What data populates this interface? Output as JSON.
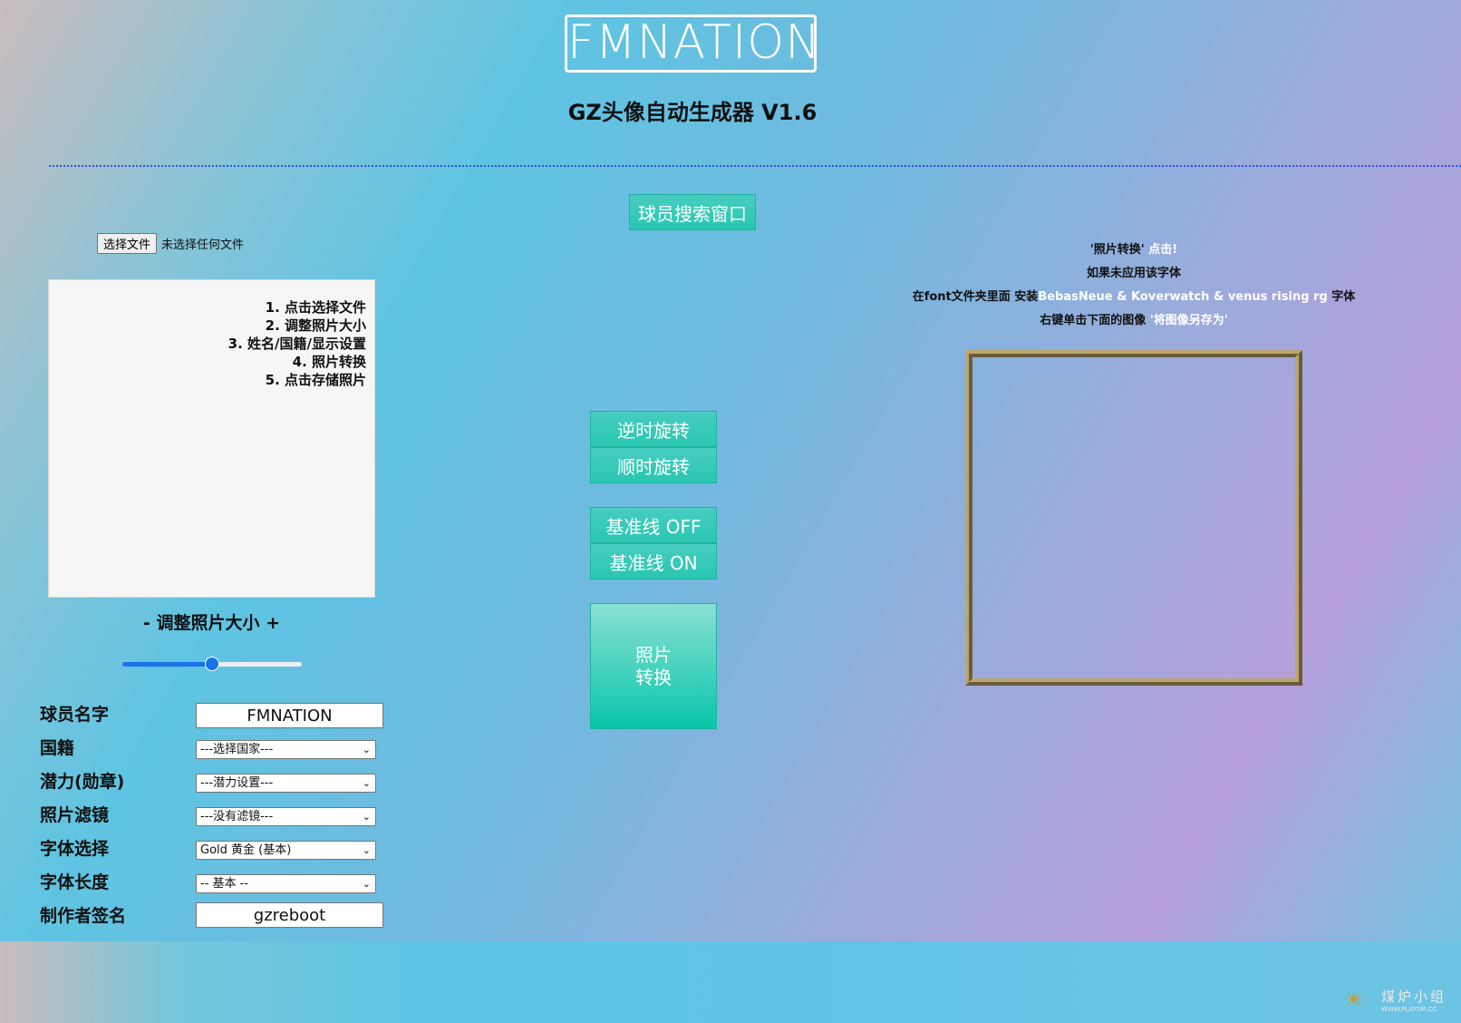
{
  "header": {
    "logo_text": "FMNATION",
    "app_title": "GZ头像自动生成器 V1.6"
  },
  "search_button": "球员搜索窗口",
  "file_input": {
    "button_label": "选择文件",
    "status": "未选择任何文件"
  },
  "instructions": [
    "1. 点击选择文件",
    "2. 调整照片大小",
    "3. 姓名/国籍/显示设置",
    "4. 照片转换",
    "5. 点击存储照片"
  ],
  "resize_label": "- 调整照片大小 +",
  "resize_slider": {
    "value": 50,
    "min": 0,
    "max": 100
  },
  "controls": {
    "rotate_ccw": "逆时旋转",
    "rotate_cw": "顺时旋转",
    "guide_off": "基准线 OFF",
    "guide_on": "基准线 ON",
    "convert_line1": "照片",
    "convert_line2": "转换"
  },
  "form": {
    "player_name": {
      "label": "球员名字",
      "value": "FMNATION"
    },
    "nationality": {
      "label": "国籍",
      "selected": "---选择国家---"
    },
    "potential": {
      "label": "潜力(勋章)",
      "selected": "---潜力设置---"
    },
    "photo_filter": {
      "label": "照片滤镜",
      "selected": "---没有滤镜---"
    },
    "font_choice": {
      "label": "字体选择",
      "selected": "Gold 黄金 (基本)"
    },
    "font_length": {
      "label": "字体长度",
      "selected": "-- 基本 --"
    },
    "creator_signature": {
      "label": "制作者签名",
      "value": "gzreboot"
    }
  },
  "info": {
    "line1_a": "'照片转换'",
    "line1_b": " 点击!",
    "line2": "如果未应用该字体",
    "line3_a": "在font文件夹里面 安装",
    "line3_b": "BebasNeue & Koverwatch & venus rising rg",
    "line3_c": " 字体",
    "line4_a": "右键单击下面的图像 ",
    "line4_b": "'将图像另存为'"
  },
  "watermark": {
    "text": "煤炉小组",
    "url": "WWW.PLAYSM.CC"
  },
  "colors": {
    "button": "#28c7b0",
    "frame": "#bca66b",
    "divider": "#2e4ee6",
    "slider": "#1a73e8"
  }
}
